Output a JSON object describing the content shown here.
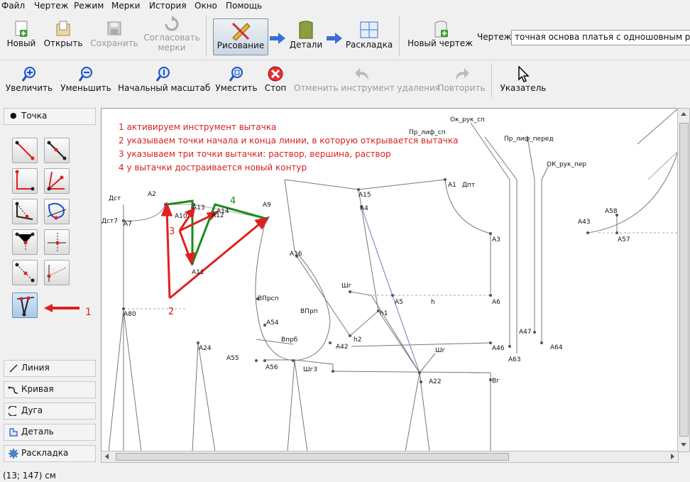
{
  "menu": [
    "Файл",
    "Чертеж",
    "Режим",
    "Мерки",
    "История",
    "Окно",
    "Помощь"
  ],
  "toolbar1": {
    "new": "Новый",
    "open": "Открыть",
    "save": "Сохранить",
    "sync1": "Согласовать",
    "sync2": "мерки",
    "draw": "Рисование",
    "details": "Детали",
    "layout": "Раскладка",
    "new_drawing": "Новый чертеж",
    "drawing_label": "Чертеж:",
    "drawing_value": "точная основа платья с одношовным рука"
  },
  "toolbar2": {
    "zoom_in": "Увеличить",
    "zoom_out": "Уменьшить",
    "initial_scale": "Начальный масштаб",
    "fit": "Уместить",
    "stop": "Стоп",
    "undo": "Отменить инструмент удаления",
    "redo": "Повторить",
    "pointer": "Указатель"
  },
  "left": {
    "point": "Точка",
    "line": "Линия",
    "curve": "Кривая",
    "arc": "Дуга",
    "detail": "Деталь",
    "layout": "Раскладка",
    "arrow_num": "1"
  },
  "annotations": [
    "1 активируем инструмент вытачка",
    "2 указываем точки начала и конца линии, в которую открывается вытачка",
    "3 указываем три точки вытачки: раствор, вершина, раствор",
    "4 у вытачки достраивается новый контур"
  ],
  "marks": {
    "n2": "2",
    "n3": "3",
    "n4": "4"
  },
  "points": {
    "dst": "Дст",
    "dst7": "Дст7",
    "a7": "А7",
    "a2": "А2",
    "a10": "А10",
    "a13": "А13",
    "a14": "А14",
    "a12": "А12",
    "a9": "А9",
    "a15": "А15",
    "a4": "А4",
    "a1": "А1",
    "dpt": "Дпт",
    "a16": "А16",
    "a3": "А3",
    "a11": "А11",
    "shg": "Шг",
    "a5": "А5",
    "h": "h",
    "a6": "А6",
    "vprsp": "ВПрсп",
    "a80": "А80",
    "vprp": "ВПрп",
    "h1": "h1",
    "a54": "А54",
    "vprb": "Впрб",
    "h2": "h2",
    "a42": "А42",
    "shg_r": "Шг",
    "a46": "А46",
    "a24": "А24",
    "a55": "А55",
    "a56": "А56",
    "shg3": "Шг3",
    "a22": "А22",
    "vg": "Вг",
    "a63": "А63",
    "a47": "А47",
    "a64": "А64",
    "pr_lif_sp": "Пр_лиф_сп",
    "ok_ruk_sp": "Ок_рук_сп",
    "pr_lif_pered": "Пр_лиф_перед",
    "ok_ruk_per": "ОК_рук_пер",
    "a43": "А43",
    "a58": "А58",
    "a57": "А57"
  },
  "status": "(13; 147) см",
  "colors": {
    "red": "#e02020",
    "green": "#1a8a1a",
    "blue": "#2050c8",
    "active": "#a9c9e7"
  }
}
